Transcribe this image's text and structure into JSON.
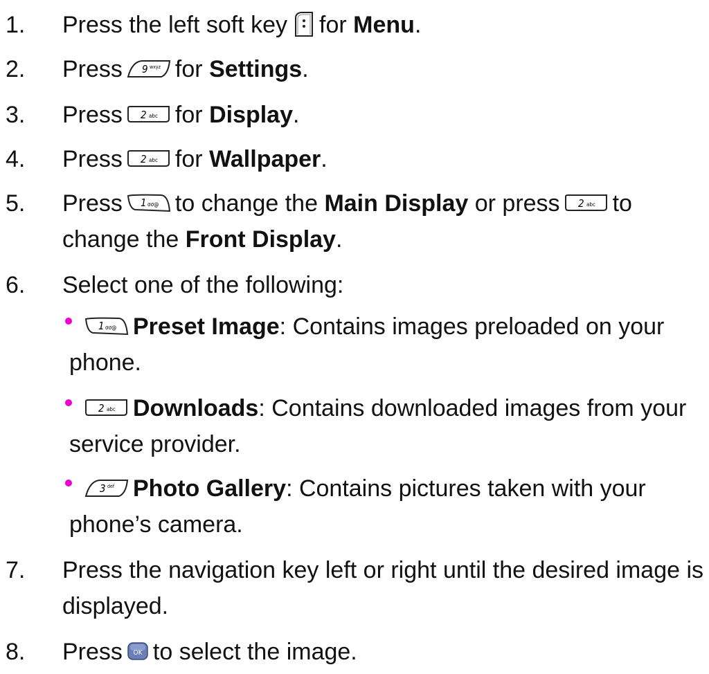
{
  "steps": [
    {
      "num": "1.",
      "pre": "Press the left soft key",
      "key": "soft-key-left",
      "mid": "for",
      "bold": "Menu",
      "post": "."
    },
    {
      "num": "2.",
      "pre": "Press",
      "key": "key-9-wxyz",
      "mid": "for",
      "bold": "Settings",
      "post": "."
    },
    {
      "num": "3.",
      "pre": "Press",
      "key": "key-2-abc",
      "mid": "for",
      "bold": "Display",
      "post": "."
    },
    {
      "num": "4.",
      "pre": "Press",
      "key": "key-2-abc",
      "mid": "for",
      "bold": "Wallpaper",
      "post": "."
    },
    {
      "num": "5.",
      "pre": "Press",
      "key": "key-1",
      "mid": "to change the",
      "bold": "Main Display",
      "post2": "or press",
      "key2": "key-2-abc",
      "tail": "to",
      "cont_pre": "change the",
      "cont_bold": "Front Display",
      "cont_post": "."
    },
    {
      "num": "6.",
      "text": "Select one of the following:"
    },
    {
      "num": "7.",
      "text": "Press the navigation key left or right until the desired image is",
      "cont": "displayed."
    },
    {
      "num": "8.",
      "pre": "Press",
      "key": "ok-key",
      "post": "to select the image."
    }
  ],
  "options": [
    {
      "key": "key-1",
      "bold": "Preset Image",
      "text": ": Contains images preloaded on your",
      "cont": "phone."
    },
    {
      "key": "key-2-abc",
      "bold": "Downloads",
      "text": ": Contains downloaded images from your",
      "cont": "service provider."
    },
    {
      "key": "key-3-def",
      "bold": "Photo Gallery",
      "text": ": Contains pictures taken with your",
      "cont": "phone’s camera."
    }
  ],
  "key_labels": {
    "k9": "9",
    "k9sub": "wxyz",
    "k2": "2",
    "k2sub": "abc",
    "k1": "1",
    "k1sub": "σσ@",
    "k3": "3",
    "k3sub": "def",
    "ok": "OK"
  },
  "colors": {
    "bullet": "#ee00cc",
    "ok_key": "#6a7fb8"
  }
}
